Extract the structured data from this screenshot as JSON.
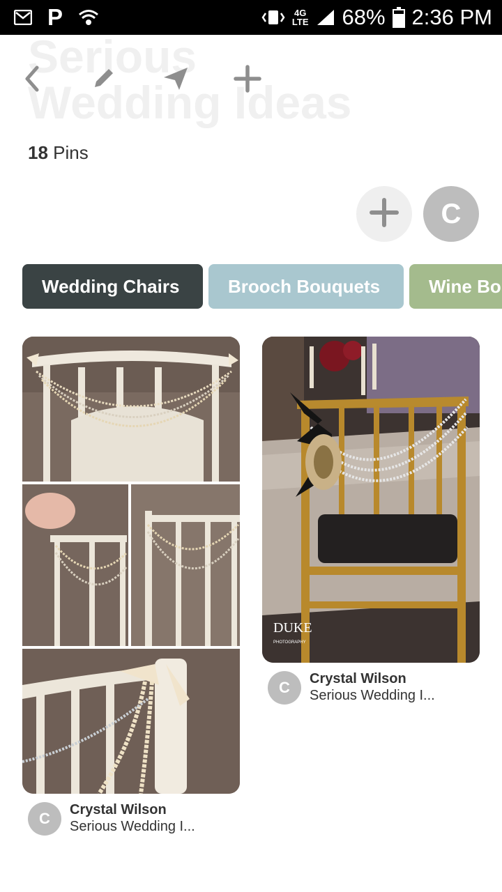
{
  "status_bar": {
    "carrier_letter": "P",
    "lte_badge": "4G\nLTE",
    "battery_percent": "68%",
    "time": "2:36 PM"
  },
  "header": {
    "ghost_title": "Serious Wedding Ideas",
    "pins_count": "18",
    "pins_label": "Pins"
  },
  "icons": {
    "back": "chevron-left-icon",
    "edit": "pencil-icon",
    "share": "paper-plane-icon",
    "add": "plus-icon"
  },
  "collaborators": {
    "avatar_initial": "C"
  },
  "sections": [
    {
      "label": "Wedding Chairs",
      "color": "#3a4344"
    },
    {
      "label": "Brooch Bouquets",
      "color": "#a9c7cf"
    },
    {
      "label": "Wine Bo",
      "color": "#a4bb8d"
    }
  ],
  "pins": [
    {
      "author": "Crystal Wilson",
      "board": "Serious Wedding I...",
      "initial": "C"
    },
    {
      "author": "Crystal Wilson",
      "board": "Serious Wedding I...",
      "initial": "C",
      "watermark": "DUKE",
      "watermark_sub": "PHOTOGRAPHY"
    }
  ]
}
